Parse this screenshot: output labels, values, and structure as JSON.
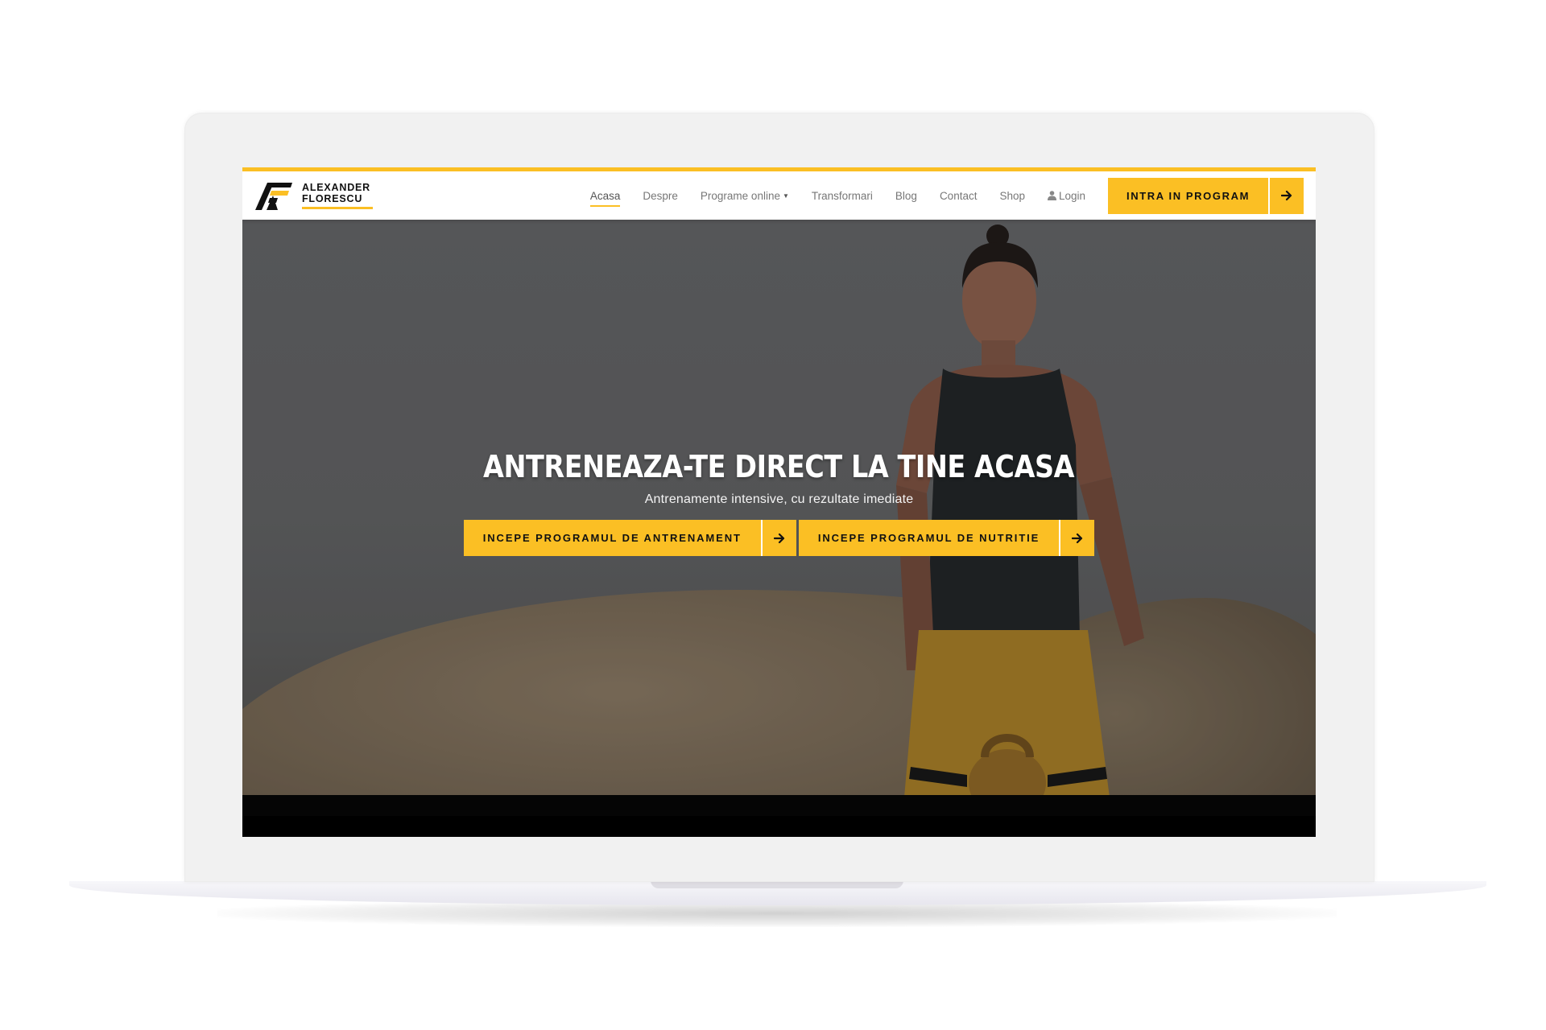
{
  "brand": {
    "line1": "ALEXANDER",
    "line2": "FLORESCU",
    "accent_color": "#fbbf24"
  },
  "nav": {
    "items": [
      {
        "label": "Acasa",
        "active": true
      },
      {
        "label": "Despre"
      },
      {
        "label": "Programe online",
        "has_dropdown": true
      },
      {
        "label": "Transformari"
      },
      {
        "label": "Blog"
      },
      {
        "label": "Contact"
      },
      {
        "label": "Shop"
      }
    ],
    "login_label": "Login",
    "login_icon": "user-icon",
    "cta_label": "INTRA IN PROGRAM",
    "cta_icon": "arrow-right-icon"
  },
  "hero": {
    "title": "ANTRENEAZA-TE DIRECT LA TINE ACASA",
    "subtitle": "Antrenamente intensive, cu rezultate imediate",
    "buttons": [
      {
        "label": "INCEPE PROGRAMUL DE ANTRENAMENT",
        "icon": "arrow-right-icon"
      },
      {
        "label": "INCEPE PROGRAMUL DE NUTRITIE",
        "icon": "arrow-right-icon"
      }
    ]
  }
}
